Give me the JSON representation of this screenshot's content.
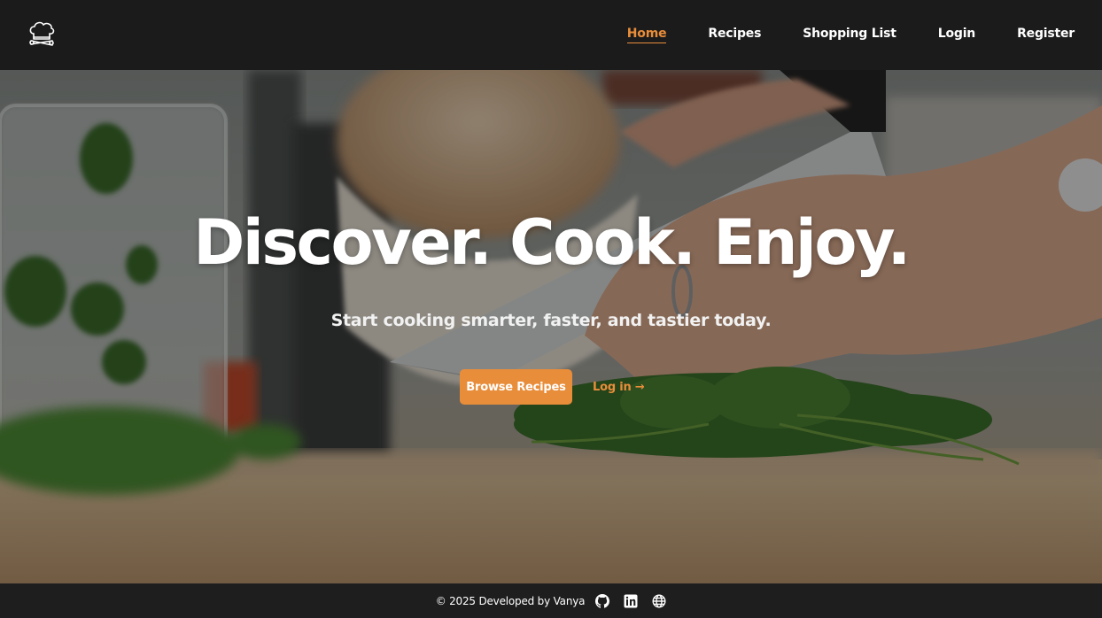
{
  "navbar": {
    "logo_icon": "chef-hat-icon",
    "links": [
      {
        "label": "Home",
        "active": true
      },
      {
        "label": "Recipes",
        "active": false
      },
      {
        "label": "Shopping List",
        "active": false
      },
      {
        "label": "Login",
        "active": false
      },
      {
        "label": "Register",
        "active": false
      }
    ]
  },
  "hero": {
    "title": "Discover. Cook. Enjoy.",
    "subtitle": "Start cooking smarter, faster, and tastier today.",
    "primary_button": "Browse Recipes",
    "secondary_link": "Log in →"
  },
  "footer": {
    "text": "© 2025 Developed by Vanya",
    "icons": [
      "github-icon",
      "linkedin-icon",
      "globe-icon"
    ]
  },
  "colors": {
    "accent": "#e88d3a",
    "navbar_bg": "#1b1b1b",
    "footer_bg": "#1e1e1e"
  }
}
